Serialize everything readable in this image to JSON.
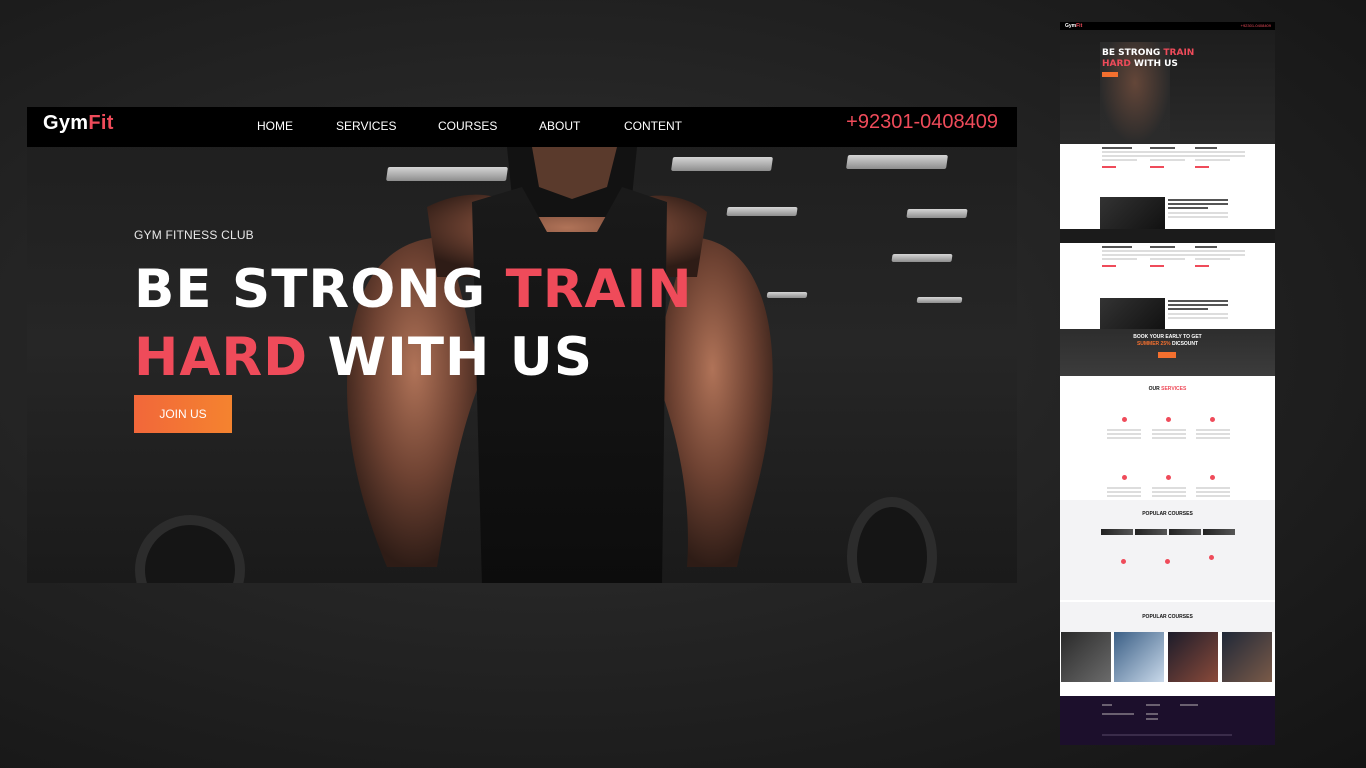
{
  "brand": {
    "name_part1": "Gym",
    "name_part2": "Fit"
  },
  "nav": {
    "items": [
      {
        "label": "HOME"
      },
      {
        "label": "SERVICES"
      },
      {
        "label": "COURSES"
      },
      {
        "label": "ABOUT"
      },
      {
        "label": "CONTENT"
      }
    ],
    "phone": "+92301-0408409"
  },
  "hero": {
    "eyebrow": "GYM FITNESS CLUB",
    "line1_white": "BE STRONG ",
    "line1_red": "TRAIN",
    "line2_red": "HARD",
    "line2_white": " WITH US",
    "cta": "JOIN US"
  },
  "mini_preview": {
    "hero_line1_white": "BE STRONG ",
    "hero_line1_red": "TRAIN",
    "hero_line2_red": "HARD",
    "hero_line2_white": " WITH US",
    "promo_line1": "BOOK YOUR EARLY TO GET",
    "promo_line2_red": "SUMMER 25%",
    "promo_line2_white": " DICSOUNT",
    "services_title_dark": "OUR ",
    "services_title_red": "SERVICES",
    "courses_title": "POPULAR COURSES",
    "courses_title_2": "POPULAR COURSES"
  },
  "colors": {
    "accent": "#ef4b5a",
    "cta_start": "#f2673a",
    "cta_end": "#f4832f",
    "nav_bg": "#000000"
  }
}
